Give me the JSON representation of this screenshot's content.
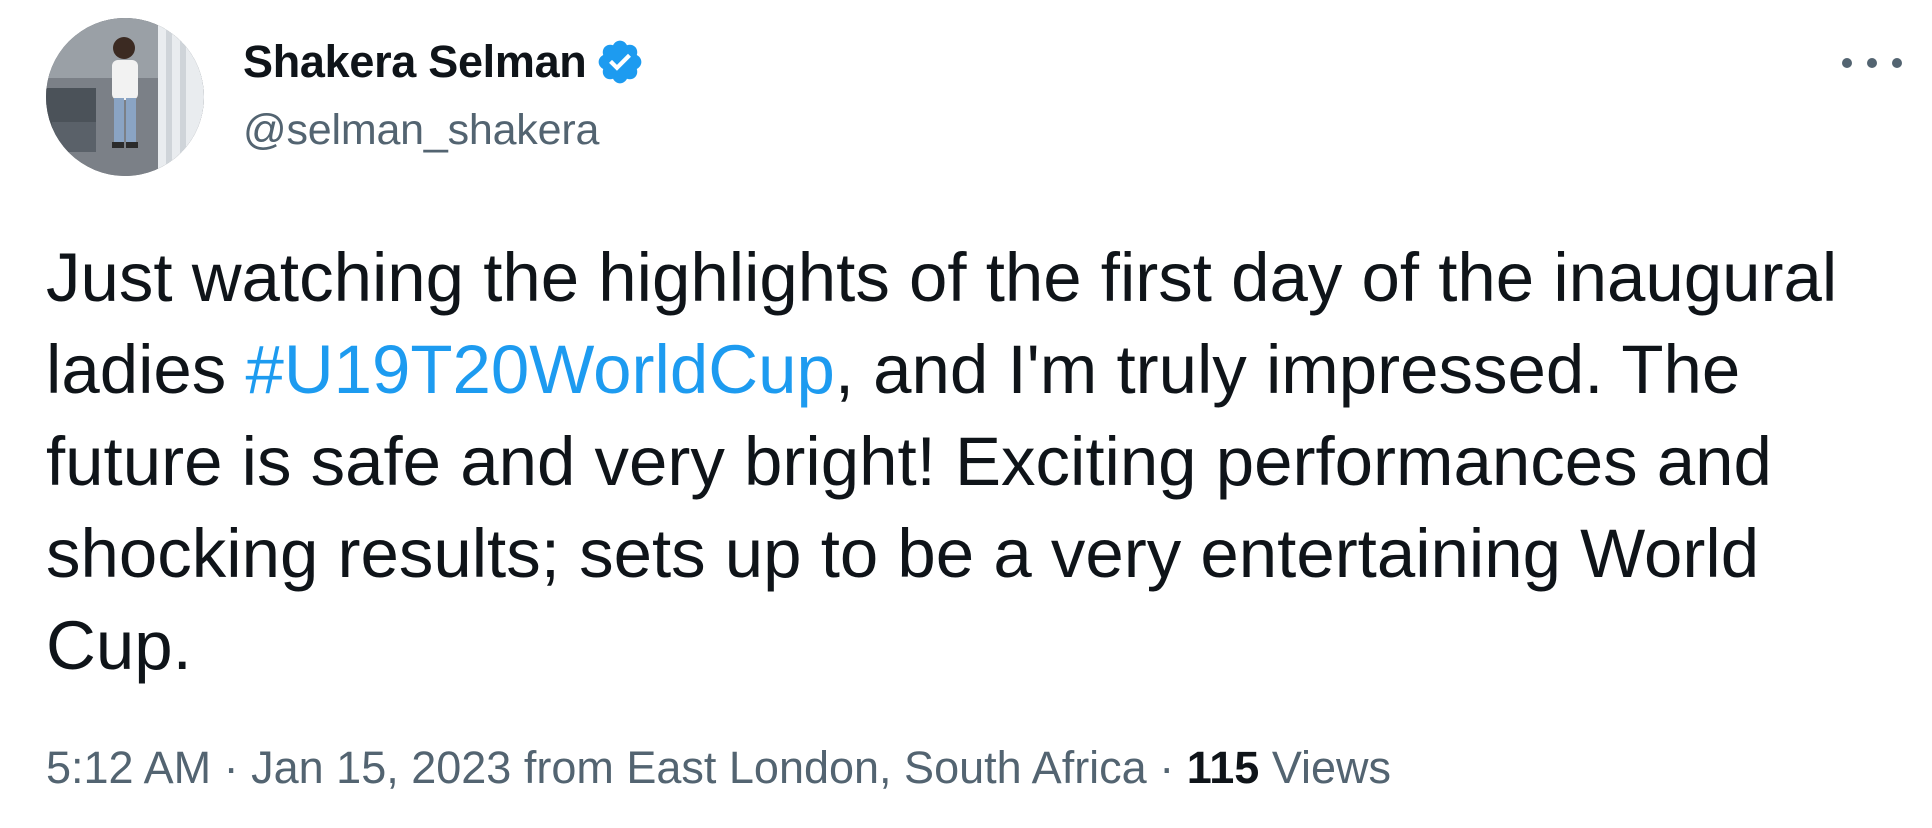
{
  "author": {
    "display_name": "Shakera Selman",
    "handle": "@selman_shakera",
    "verified": true
  },
  "tweet": {
    "text_before": "Just watching the highlights of the first day of the inaugural ladies ",
    "hashtag": "#U19T20WorldCup",
    "text_after": ", and I'm truly impressed. The future is safe and very bright! Exciting performances and shocking results; sets up to be a very entertaining World Cup."
  },
  "meta": {
    "time": "5:12 AM",
    "separator1": " · ",
    "date": "Jan 15, 2023",
    "location_text": " from East London, South Africa",
    "separator2": " · ",
    "views_count": "115",
    "views_label": " Views"
  },
  "icons": {
    "verified": "verified-badge-icon",
    "more": "more-options-icon"
  },
  "colors": {
    "link": "#1d9bf0",
    "text": "#0f1419",
    "secondary": "#536471",
    "verified": "#1d9bf0"
  }
}
